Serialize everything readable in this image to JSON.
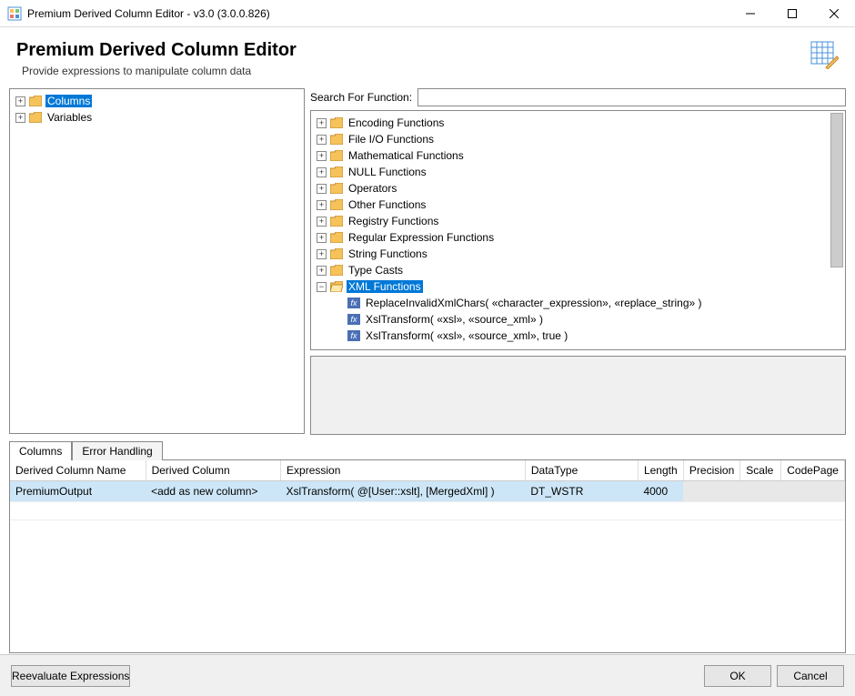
{
  "window": {
    "title": "Premium Derived Column Editor - v3.0 (3.0.0.826)"
  },
  "header": {
    "title": "Premium Derived Column Editor",
    "subtitle": "Provide expressions to manipulate column data"
  },
  "leftTree": {
    "items": [
      {
        "label": "Columns",
        "selected": true
      },
      {
        "label": "Variables",
        "selected": false
      }
    ]
  },
  "search": {
    "label": "Search For Function:",
    "value": ""
  },
  "funcTree": {
    "folders": [
      "Encoding Functions",
      "File I/O Functions",
      "Mathematical Functions",
      "NULL Functions",
      "Operators",
      "Other Functions",
      "Registry Functions",
      "Regular Expression Functions",
      "String Functions",
      "Type Casts"
    ],
    "expanded": {
      "label": "XML Functions",
      "children": [
        "ReplaceInvalidXmlChars( «character_expression», «replace_string» )",
        "XslTransform( «xsl», «source_xml» )",
        "XslTransform( «xsl», «source_xml», true )"
      ]
    }
  },
  "tabs": {
    "items": [
      "Columns",
      "Error Handling"
    ],
    "active": 0
  },
  "grid": {
    "headers": [
      "Derived Column Name",
      "Derived Column",
      "Expression",
      "DataType",
      "Length",
      "Precision",
      "Scale",
      "CodePage"
    ],
    "rows": [
      {
        "name": "PremiumOutput",
        "derived": "<add as new column>",
        "expr": "XslTransform( @[User::xslt], [MergedXml] )",
        "dtype": "DT_WSTR",
        "len": "4000",
        "prec": "",
        "scale": "",
        "cp": ""
      }
    ]
  },
  "buttons": {
    "reevaluate": "Reevaluate Expressions",
    "ok": "OK",
    "cancel": "Cancel"
  }
}
